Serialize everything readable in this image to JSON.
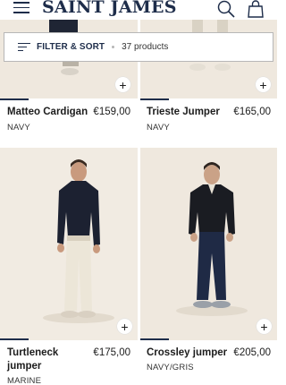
{
  "header": {
    "brand": "SAINT JAMES",
    "menu_icon": "hamburger-icon",
    "search_icon": "search-icon",
    "bag_icon": "shopping-bag-icon",
    "brand_color": "#1e2d4a"
  },
  "filter": {
    "label": "FILTER & SORT",
    "count": "37 products"
  },
  "products": [
    {
      "name": "Matteo Cardigan",
      "price": "€159,00",
      "color": "NAVY"
    },
    {
      "name": "Trieste Jumper",
      "price": "€165,00",
      "color": "NAVY"
    },
    {
      "name": "Turtleneck jumper",
      "price": "€175,00",
      "color": "MARINE"
    },
    {
      "name": "Crossley jumper",
      "price": "€205,00",
      "color": "NAVY/GRIS"
    }
  ],
  "add_symbol": "+"
}
